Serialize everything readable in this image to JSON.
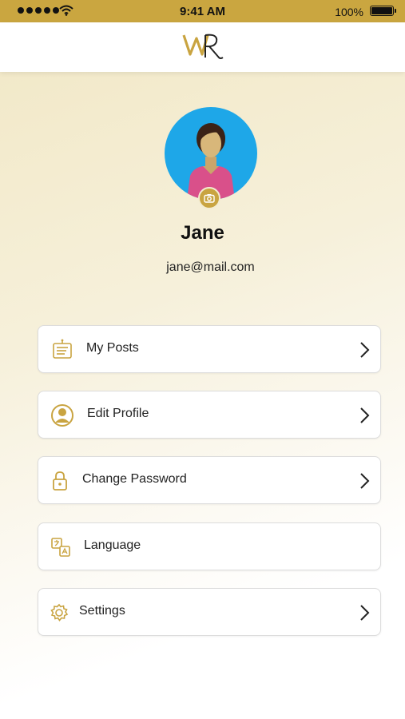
{
  "status_bar": {
    "time": "9:41 AM",
    "battery": "100%"
  },
  "header": {
    "logo_text": "WR",
    "logo_color": "#c9a441"
  },
  "profile": {
    "name": "Jane",
    "email": "jane@mail.com",
    "avatar_bg": "#1ea7e8"
  },
  "menu": {
    "items": [
      {
        "label": "My Posts",
        "icon": "posts-icon",
        "has_chevron": true
      },
      {
        "label": "Edit Profile",
        "icon": "user-circle-icon",
        "has_chevron": true
      },
      {
        "label": "Change Password",
        "icon": "lock-icon",
        "has_chevron": true
      },
      {
        "label": "Language",
        "icon": "translate-icon",
        "has_chevron": false
      },
      {
        "label": "Settings",
        "icon": "gear-icon",
        "has_chevron": true
      }
    ]
  },
  "colors": {
    "accent": "#c9a441",
    "status_bar": "#caa640"
  }
}
